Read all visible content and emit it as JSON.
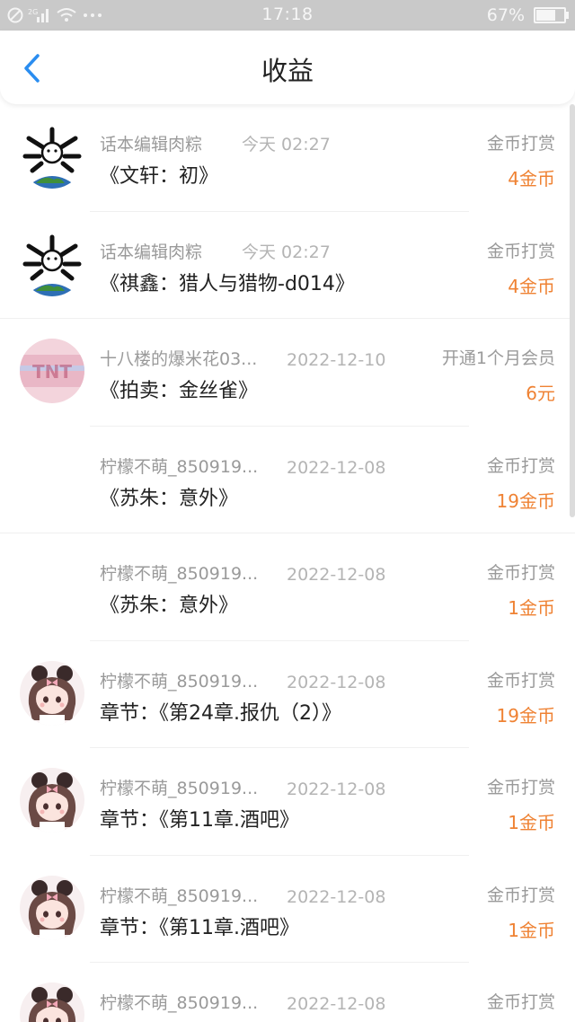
{
  "status_bar": {
    "time": "17:18",
    "battery": "67%",
    "battery_level": 0.67,
    "network": "2G"
  },
  "header": {
    "title": "收益",
    "back_icon": "chevron-left-icon",
    "accent": "#2a8df0"
  },
  "colors": {
    "amount": "#ef8233",
    "meta": "#9a9a9a"
  },
  "records": [
    {
      "user": "话本编辑肉粽",
      "time": "今天 02:27",
      "work": "《文轩：初》",
      "type": "金币打赏",
      "amount": "4金币",
      "avatar": "earth-bone-icon"
    },
    {
      "user": "话本编辑肉粽",
      "time": "今天 02:27",
      "work": "《祺鑫：猎人与猎物-d014》",
      "type": "金币打赏",
      "amount": "4金币",
      "avatar": "earth-bone-icon"
    },
    {
      "user": "十八楼的爆米花03...",
      "time": "2022-12-10",
      "work": "《拍卖：金丝雀》",
      "type": "开通1个月会员",
      "amount": "6元",
      "avatar": "tnt-blur-icon"
    },
    {
      "user": "柠檬不萌_850919...",
      "time": "2022-12-08",
      "work": "《苏朱：意外》",
      "type": "金币打赏",
      "amount": "19金币",
      "avatar": ""
    },
    {
      "user": "柠檬不萌_850919...",
      "time": "2022-12-08",
      "work": "《苏朱：意外》",
      "type": "金币打赏",
      "amount": "1金币",
      "avatar": ""
    },
    {
      "user": "柠檬不萌_850919...",
      "time": "2022-12-08",
      "work": "章节：《第24章.报仇（2）》",
      "type": "金币打赏",
      "amount": "19金币",
      "avatar": "anime-girl-icon"
    },
    {
      "user": "柠檬不萌_850919...",
      "time": "2022-12-08",
      "work": "章节：《第11章.酒吧》",
      "type": "金币打赏",
      "amount": "1金币",
      "avatar": "anime-girl-icon"
    },
    {
      "user": "柠檬不萌_850919...",
      "time": "2022-12-08",
      "work": "章节：《第11章.酒吧》",
      "type": "金币打赏",
      "amount": "1金币",
      "avatar": "anime-girl-icon"
    },
    {
      "user": "柠檬不萌_850919...",
      "time": "2022-12-08",
      "work": "",
      "type": "金币打赏",
      "amount": "",
      "avatar": "anime-girl-icon"
    }
  ]
}
